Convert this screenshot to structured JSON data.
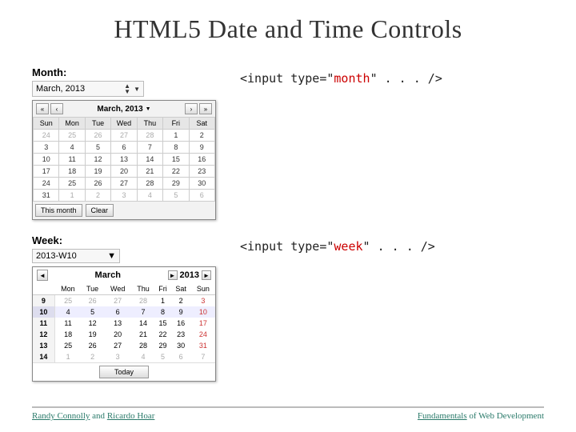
{
  "title": "HTML5 Date and Time Controls",
  "month_example": {
    "label": "Month:",
    "field_value": "March, 2013",
    "current_label": "March, 2013",
    "nav_prev_fast": "«",
    "nav_prev": "‹",
    "nav_next": "›",
    "nav_next_fast": "»",
    "weekdays": [
      "Sun",
      "Mon",
      "Tue",
      "Wed",
      "Thu",
      "Fri",
      "Sat"
    ],
    "rows": [
      {
        "cells": [
          "24",
          "25",
          "26",
          "27",
          "28",
          "1",
          "2"
        ],
        "leading_other": 5
      },
      {
        "cells": [
          "3",
          "4",
          "5",
          "6",
          "7",
          "8",
          "9"
        ]
      },
      {
        "cells": [
          "10",
          "11",
          "12",
          "13",
          "14",
          "15",
          "16"
        ]
      },
      {
        "cells": [
          "17",
          "18",
          "19",
          "20",
          "21",
          "22",
          "23"
        ]
      },
      {
        "cells": [
          "24",
          "25",
          "26",
          "27",
          "28",
          "29",
          "30"
        ]
      },
      {
        "cells": [
          "31",
          "1",
          "2",
          "3",
          "4",
          "5",
          "6"
        ],
        "trailing_other": 6
      }
    ],
    "footer_btns": [
      "This month",
      "Clear"
    ],
    "code_parts": [
      "<input type=\"",
      "month",
      "\" . . . />"
    ]
  },
  "week_example": {
    "label": "Week:",
    "field_value": "2013-W10",
    "month_title": "March",
    "year": "2013",
    "nav_prev": "◄",
    "nav_next": "►",
    "weekdays_wk": "",
    "weekdays": [
      "Mon",
      "Tue",
      "Wed",
      "Thu",
      "Fri",
      "Sat",
      "Sun"
    ],
    "rows": [
      {
        "wk": "9",
        "cells": [
          "25",
          "26",
          "27",
          "28",
          "1",
          "2",
          "3"
        ],
        "leading_other": 4
      },
      {
        "wk": "10",
        "cells": [
          "4",
          "5",
          "6",
          "7",
          "8",
          "9",
          "10"
        ],
        "selected": true
      },
      {
        "wk": "11",
        "cells": [
          "11",
          "12",
          "13",
          "14",
          "15",
          "16",
          "17"
        ]
      },
      {
        "wk": "12",
        "cells": [
          "18",
          "19",
          "20",
          "21",
          "22",
          "23",
          "24"
        ]
      },
      {
        "wk": "13",
        "cells": [
          "25",
          "26",
          "27",
          "28",
          "29",
          "30",
          "31"
        ]
      },
      {
        "wk": "14",
        "cells": [
          "1",
          "2",
          "3",
          "4",
          "5",
          "6",
          "7"
        ],
        "trailing_other": 7
      }
    ],
    "today_label": "Today",
    "code_parts": [
      "<input type=\"",
      "week",
      "\" . . . />"
    ]
  },
  "footer": {
    "left_u1": "Randy Connolly",
    "left_mid": " and ",
    "left_u2": "Ricardo ",
    "left_u3": "Hoar",
    "right_u": "Fundamentals",
    "right_rest": " of Web Development"
  }
}
